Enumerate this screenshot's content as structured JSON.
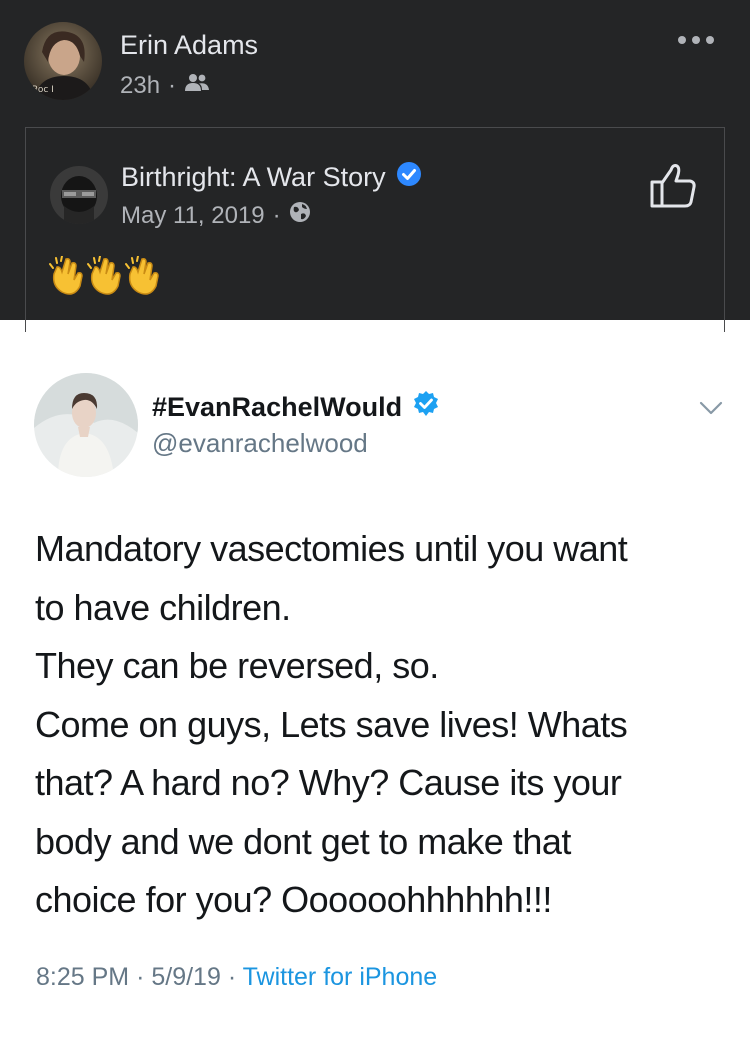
{
  "facebook_post": {
    "author": "Erin Adams",
    "time": "23h",
    "separator": "·",
    "audience_icon": "friends-icon",
    "more_icon": "more-dots-icon",
    "shared_post": {
      "page_name": "Birthright: A War Story",
      "verified_icon": "verified-badge-icon",
      "date": "May 11, 2019",
      "separator": "·",
      "audience_icon": "globe-icon",
      "like_icon": "thumbs-up-icon",
      "body_emojis": [
        "clapping-hands-icon",
        "clapping-hands-icon",
        "clapping-hands-icon"
      ]
    }
  },
  "tweet": {
    "display_name": "#EvanRachelWould",
    "verified_icon": "verified-badge-icon",
    "handle": "@evanrachelwood",
    "menu_icon": "chevron-down-icon",
    "lines": [
      "Mandatory vasectomies until you want",
      "to have children.",
      "They can be reversed, so.",
      "Come on guys, Lets save lives! Whats",
      "that? A hard no? Why? Cause its your",
      "body and we dont get to make that",
      "choice for you? Oooooohhhhhh!!!"
    ],
    "time": "8:25 PM",
    "date": "5/9/19",
    "separator": "·",
    "source": "Twitter for iPhone",
    "colors": {
      "text": "#14171a",
      "muted": "#657786",
      "link": "#1b95e0",
      "verified": "#1da1f2"
    }
  }
}
